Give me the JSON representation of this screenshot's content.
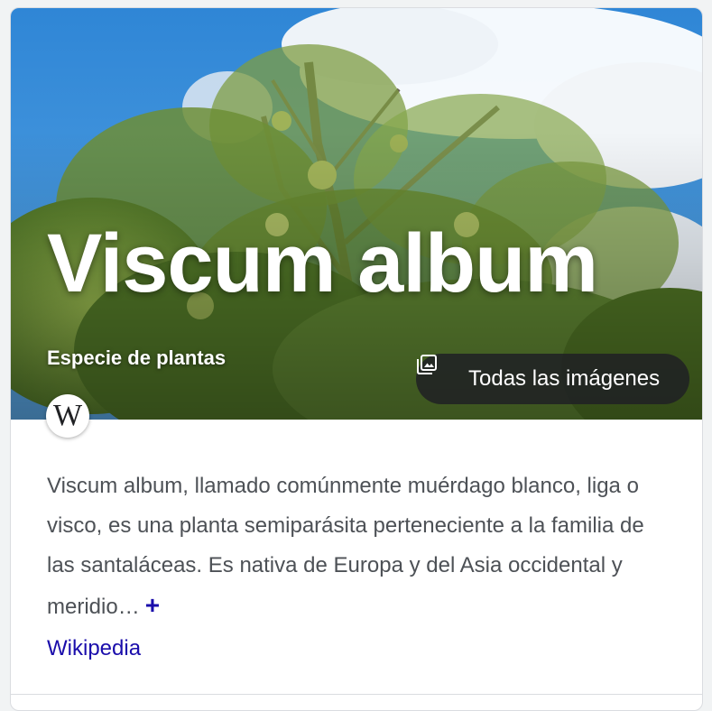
{
  "knowledge_panel": {
    "title": "Viscum album",
    "subtitle": "Especie de plantas",
    "images_button_label": "Todas las imágenes",
    "images_button_icon": "photo-library-icon",
    "source_logo_glyph": "W",
    "source_logo_icon": "wikipedia-logo-icon",
    "description": "Viscum album, llamado comúnmente muérdago blanco, liga o visco, es una planta semiparásita perteneciente a la familia de las santaláceas. Es nativa de Europa y del Asia occidental y meridio…",
    "more_toggle": "+",
    "source_link": "Wikipedia"
  },
  "colors": {
    "link": "#1a0dab",
    "body_text": "#4d5156",
    "sky": "#3f95dc",
    "button_bg": "#202124"
  }
}
